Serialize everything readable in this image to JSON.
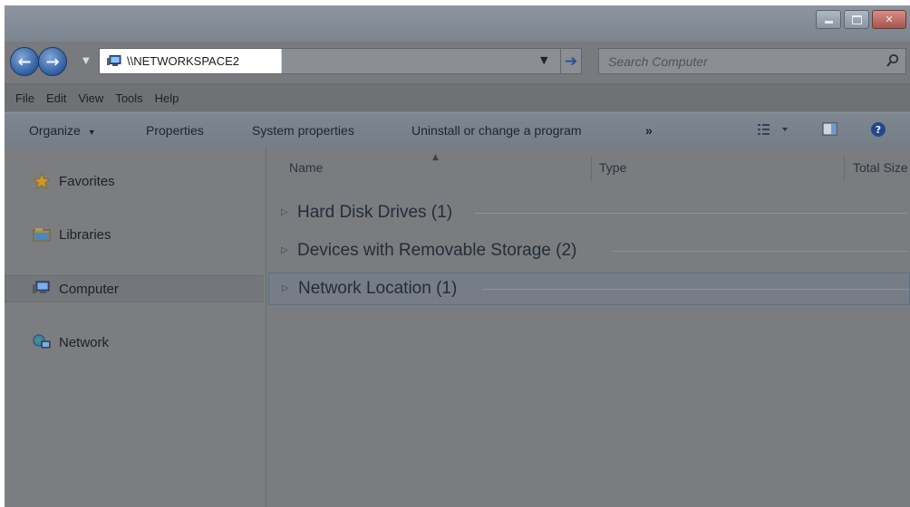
{
  "window": {
    "caption_buttons": [
      "minimize",
      "maximize",
      "close"
    ]
  },
  "navigation": {
    "address": "\\\\NETWORKSPACE2",
    "search_placeholder": "Search Computer"
  },
  "menubar": {
    "items": [
      "File",
      "Edit",
      "View",
      "Tools",
      "Help"
    ]
  },
  "commandbar": {
    "organize": "Organize",
    "properties": "Properties",
    "system_properties": "System properties",
    "uninstall": "Uninstall or change a program",
    "more": "»"
  },
  "sidebar": {
    "items": [
      {
        "label": "Favorites",
        "icon": "star-icon"
      },
      {
        "label": "Libraries",
        "icon": "libraries-icon"
      },
      {
        "label": "Computer",
        "icon": "computer-icon",
        "selected": true
      },
      {
        "label": "Network",
        "icon": "network-icon"
      }
    ]
  },
  "content": {
    "columns": [
      "Name",
      "Type",
      "Total Size"
    ],
    "groups": [
      {
        "label": "Hard Disk Drives (1)",
        "expanded": false
      },
      {
        "label": "Devices with Removable Storage (2)",
        "expanded": false
      },
      {
        "label": "Network Location (1)",
        "expanded": false,
        "selected": true
      }
    ]
  },
  "colors": {
    "accent_blue": "#2f5da0",
    "close_red": "#a4554c",
    "overlay_gray": "#787a7e"
  }
}
